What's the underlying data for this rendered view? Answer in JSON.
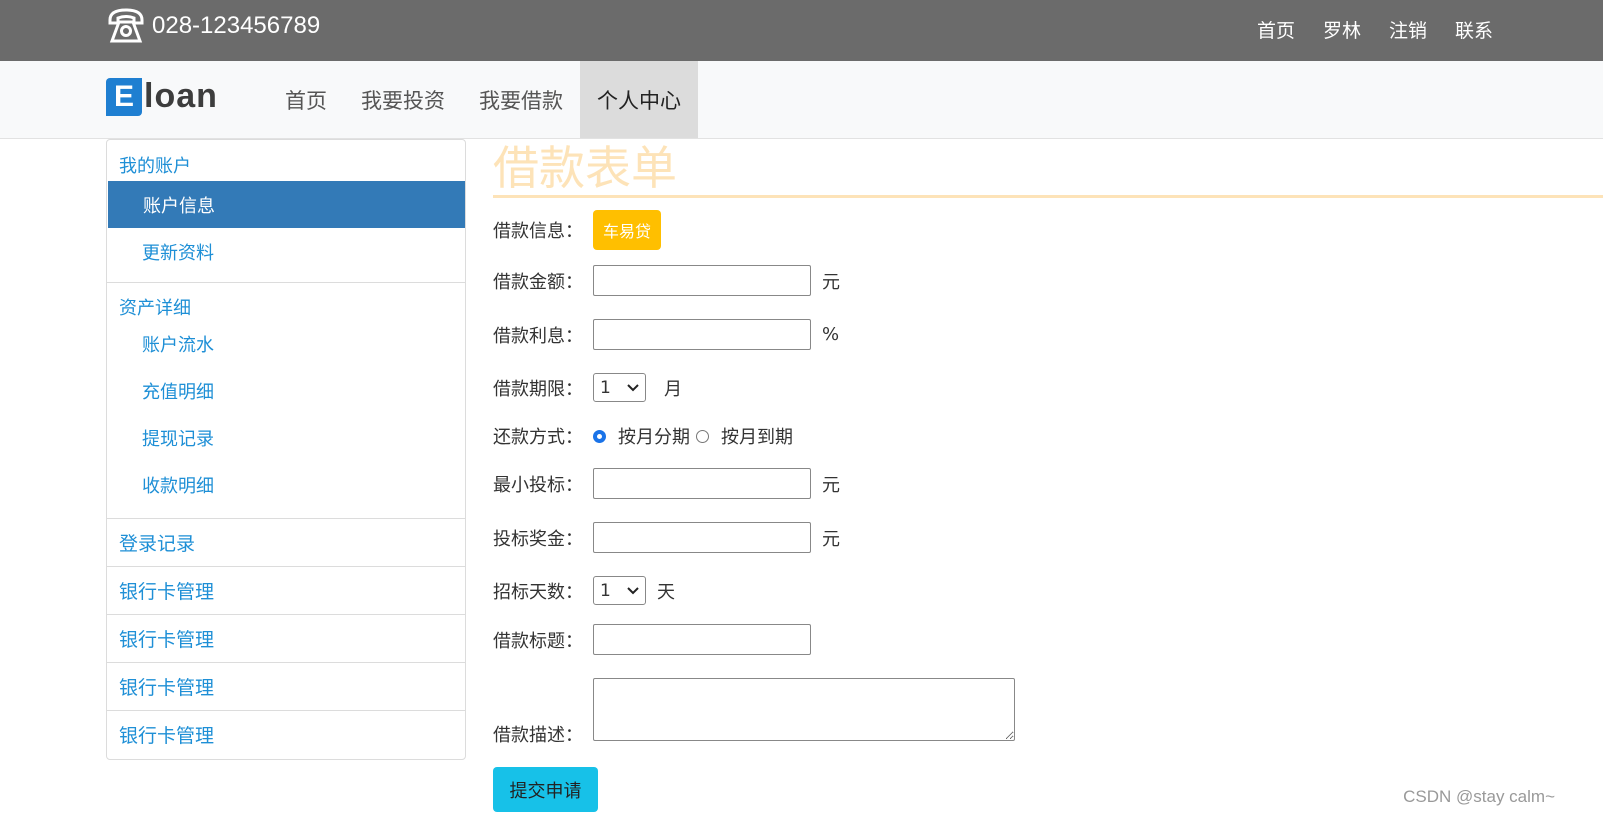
{
  "header": {
    "phone": "028-123456789",
    "links": [
      "首页",
      "罗林",
      "注销",
      "联系"
    ]
  },
  "navbar": {
    "logo_first": "E",
    "logo_rest": "loan",
    "items": [
      "首页",
      "我要投资",
      "我要借款",
      "个人中心"
    ],
    "active": "个人中心"
  },
  "sidebar": {
    "account_title": "我的账户",
    "account_items": [
      "账户信息",
      "更新资料"
    ],
    "asset_title": "资产详细",
    "asset_items": [
      "账户流水",
      "充值明细",
      "提现记录",
      "收款明细"
    ],
    "links": [
      "登录记录",
      "银行卡管理",
      "银行卡管理",
      "银行卡管理",
      "银行卡管理"
    ]
  },
  "form": {
    "title": "借款表单",
    "loan_info_label": "借款信息：",
    "loan_info_badge": "车易贷",
    "amount_label": "借款金额：",
    "amount_unit": "元",
    "interest_label": "借款利息：",
    "interest_unit": "%",
    "term_label": "借款期限：",
    "term_value": "1",
    "term_unit": "月",
    "repay_label": "还款方式：",
    "repay_option1": "按月分期",
    "repay_option2": "按月到期",
    "min_bid_label": "最小投标：",
    "min_bid_unit": "元",
    "bonus_label": "投标奖金：",
    "bonus_unit": "元",
    "days_label": "招标天数：",
    "days_value": "1",
    "days_unit": "天",
    "loan_title_label": "借款标题：",
    "desc_label": "借款描述：",
    "submit": "提交申请"
  },
  "watermark": "CSDN @stay calm~",
  "colors": {
    "accent": "#337ab7",
    "badge": "#ffbf00",
    "submit": "#17c1e8",
    "title": "#fde3b8"
  }
}
